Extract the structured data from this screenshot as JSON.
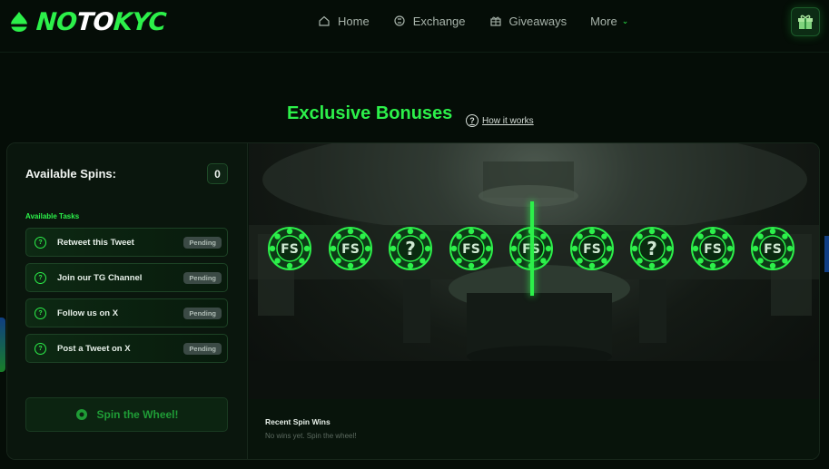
{
  "header": {
    "logo": {
      "part1": "NO",
      "part2": "TO",
      "part3": "KYC"
    },
    "nav": [
      {
        "label": "Home",
        "icon": "home-icon"
      },
      {
        "label": "Exchange",
        "icon": "exchange-icon"
      },
      {
        "label": "Giveaways",
        "icon": "gift-icon"
      },
      {
        "label": "More",
        "icon": "chevron-down-icon"
      }
    ],
    "gift_button_icon": "gift-box-icon"
  },
  "main": {
    "title": "Exclusive Bonuses",
    "how_it_works": "How it works",
    "available_spins_label": "Available Spins:",
    "available_spins_value": "0",
    "tasks_label": "Available Tasks",
    "tasks": [
      {
        "label": "Retweet this Tweet",
        "status": "Pending"
      },
      {
        "label": "Join our TG Channel",
        "status": "Pending"
      },
      {
        "label": "Follow us on X",
        "status": "Pending"
      },
      {
        "label": "Post a Tweet on X",
        "status": "Pending"
      }
    ],
    "spin_button": "Spin the Wheel!",
    "wheel_items": [
      "FS",
      "FS",
      "?",
      "FS",
      "FS",
      "FS",
      "?",
      "FS",
      "FS"
    ],
    "recent_title": "Recent Spin Wins",
    "recent_empty": "No wins yet. Spin the wheel!"
  },
  "colors": {
    "accent": "#2cf04a",
    "background": "#050d07",
    "badge": "#3b4a45"
  }
}
